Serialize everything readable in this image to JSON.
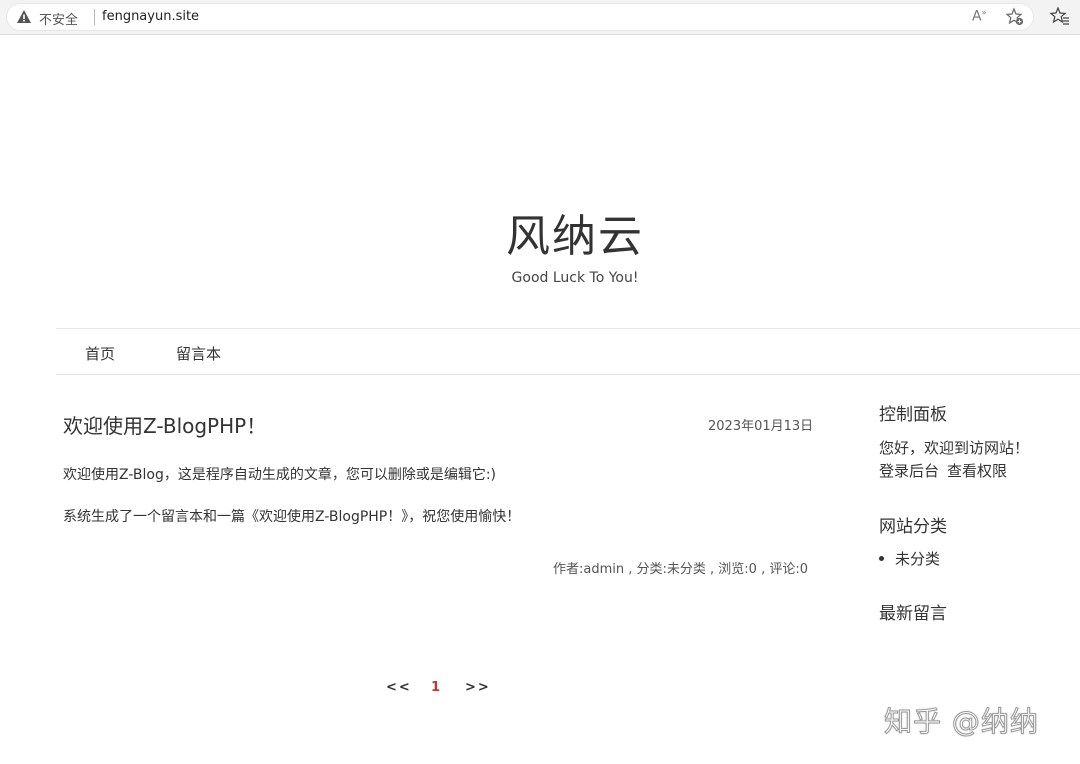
{
  "browser": {
    "security_label": "不安全",
    "url": "fengnayun.site"
  },
  "header": {
    "title": "风纳云",
    "subtitle": "Good Luck To You!"
  },
  "nav": {
    "items": [
      {
        "label": "首页"
      },
      {
        "label": "留言本"
      }
    ]
  },
  "post": {
    "title": "欢迎使用Z-BlogPHP！",
    "date": "2023年01月13日",
    "paragraphs": [
      "欢迎使用Z-Blog，这是程序自动生成的文章，您可以删除或是编辑它:)",
      "系统生成了一个留言本和一篇《欢迎使用Z-BlogPHP！》，祝您使用愉快！"
    ],
    "meta": "作者:admin , 分类:未分类 , 浏览:0 , 评论:0"
  },
  "pagination": {
    "prev": "<<",
    "current": "1",
    "next": ">>"
  },
  "sidebar": {
    "control_panel": {
      "heading": "控制面板",
      "welcome": "您好，欢迎到访网站！",
      "login": "登录后台",
      "permissions": "查看权限"
    },
    "categories": {
      "heading": "网站分类",
      "items": [
        "未分类"
      ]
    },
    "latest_comments": {
      "heading": "最新留言"
    }
  },
  "watermark": "知乎 @纳纳",
  "colors": {
    "accent": "#c0392b",
    "text": "#333333"
  },
  "icons": [
    "warning-icon",
    "read-aloud-icon",
    "add-favorite-icon",
    "favorites-icon"
  ]
}
